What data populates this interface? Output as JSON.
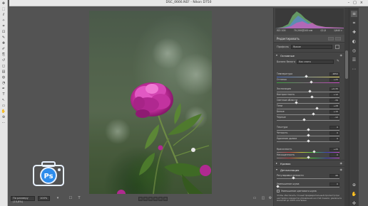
{
  "window": {
    "title": "DSC_0666.NEF  -  Nikon D750"
  },
  "toolbar_left": {
    "tools": [
      "move-icon",
      "marquee-icon",
      "lasso-icon",
      "quick-select-icon",
      "crop-icon",
      "frame-icon",
      "eyedropper-icon",
      "heal-icon",
      "brush-icon",
      "stamp-icon",
      "history-brush-icon",
      "eraser-icon",
      "gradient-icon",
      "blur-icon",
      "dodge-icon",
      "pen-icon",
      "type-icon",
      "path-select-icon",
      "shape-icon",
      "hand-icon",
      "zoom-icon",
      "more-icon"
    ]
  },
  "status": {
    "zoom_fit": "По размеру (15,8%)",
    "zoom_percent": "100%"
  },
  "camera_info": {
    "iso": "ISO 100",
    "focal": "70-200@200 мм",
    "aperture": "f/2,8",
    "shutter": "1/640 с"
  },
  "panel": {
    "title": "Редактировать",
    "profile_label": "Профиль",
    "profile_value": "Яркие",
    "sections": {
      "basic": "Основные",
      "curve": "Кривая",
      "detail": "Детализация"
    },
    "wb_label": "Баланс белого",
    "wb_value": "Как снято",
    "sliders": [
      {
        "label": "Температура",
        "value": "4850",
        "pos": 0.47,
        "kind": "temp"
      },
      {
        "label": "Оттенок",
        "value": "+25",
        "pos": 0.55,
        "kind": "tint"
      },
      {
        "label": "Экспозиция",
        "value": "+0,35",
        "pos": 0.53,
        "kind": "plain"
      },
      {
        "label": "Контрастность",
        "value": "+12",
        "pos": 0.56,
        "kind": "plain"
      },
      {
        "label": "Светлые области",
        "value": "-39",
        "pos": 0.31,
        "kind": "plain"
      },
      {
        "label": "Тени",
        "value": "+28",
        "pos": 0.64,
        "kind": "plain"
      },
      {
        "label": "Белые",
        "value": "+15",
        "pos": 0.58,
        "kind": "plain"
      },
      {
        "label": "Черные",
        "value": "-12",
        "pos": 0.44,
        "kind": "plain"
      },
      {
        "label": "Текстура",
        "value": "0",
        "pos": 0.5,
        "kind": "plain"
      },
      {
        "label": "Четкость",
        "value": "0",
        "pos": 0.5,
        "kind": "plain"
      },
      {
        "label": "Удаление дымки",
        "value": "0",
        "pos": 0.5,
        "kind": "plain"
      },
      {
        "label": "Красочность",
        "value": "+20",
        "pos": 0.6,
        "kind": "sat"
      },
      {
        "label": "Насыщенность",
        "value": "0",
        "pos": 0.5,
        "kind": "sat"
      }
    ],
    "detail_sliders": [
      {
        "label": "Регулировка резкости",
        "value": "40",
        "pos": 0.27
      },
      {
        "label": "Уменьшение шума",
        "value": "0",
        "pos": 0.02
      }
    ],
    "detail_checkbox": "Уменьшение цветового шума",
    "detail_hint": "Чтобы обеспечить точный предварительный просмотр при настройке элементов управления на этой панели, увеличьте масштаб до 100% или выше"
  },
  "colors": {
    "accent": "#2d8ceb",
    "flower": "#c0309c",
    "panel_bg": "#454545",
    "canvas_bg": "#535353"
  }
}
